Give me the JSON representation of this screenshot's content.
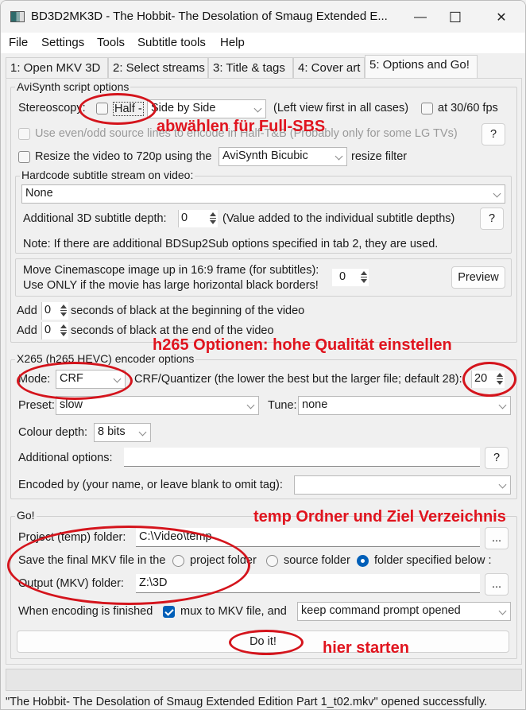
{
  "window": {
    "title": "BD3D2MK3D - The Hobbit- The Desolation of Smaug Extended E...",
    "controls": {
      "minimize": "—",
      "maximize": "☐",
      "close": "✕"
    }
  },
  "menu": [
    "File",
    "Settings",
    "Tools",
    "Subtitle tools",
    "Help"
  ],
  "tabs": [
    {
      "label": "1: Open MKV 3D",
      "active": false
    },
    {
      "label": "2: Select streams",
      "active": false
    },
    {
      "label": "3: Title & tags",
      "active": false
    },
    {
      "label": "4: Cover art",
      "active": false
    },
    {
      "label": "5: Options and Go!",
      "active": true
    }
  ],
  "avisynth": {
    "group_label": "AviSynth script options",
    "stereoscopy_label": "Stereoscopy:",
    "half_label": "Half -",
    "half_checked": false,
    "stereo_mode": "Side by Side",
    "left_view_note": "(Left view first in all cases)",
    "fps_label": "at 30/60 fps",
    "fps_checked": false,
    "even_odd_label": "Use even/odd source lines to encode in Half-T&B (Probably only for some LG TVs)",
    "even_odd_checked": false,
    "help_label": "?",
    "resize_label": "Resize the video to 720p  using the",
    "resize_checked": false,
    "resize_filter": "AviSynth Bicubic",
    "resize_suffix": "resize filter",
    "hardcode": {
      "group_label": "Hardcode subtitle stream on video:",
      "stream": "None",
      "depth_label": "Additional 3D subtitle depth:",
      "depth_value": "0",
      "depth_note": "(Value added to the individual subtitle depths)",
      "help_label": "?",
      "note": "Note:  If there are additional BDSup2Sub options specified in tab 2, they are used."
    },
    "cinemascope": {
      "line1": "Move Cinemascope image up in 16:9 frame (for subtitles):",
      "line2": "Use ONLY if the movie has large horizontal black borders!",
      "value": "0",
      "preview_label": "Preview"
    },
    "black_begin": {
      "prefix": "Add",
      "value": "0",
      "suffix": "seconds of black at the beginning of the video"
    },
    "black_end": {
      "prefix": "Add",
      "value": "0",
      "suffix": "seconds of black at the end of the video"
    }
  },
  "x265": {
    "group_label": "X265 (h265 HEVC) encoder options",
    "mode_label": "Mode:",
    "mode": "CRF",
    "crf_label": "CRF/Quantizer (the lower the best but the larger file; default 28):",
    "crf_value": "20",
    "preset_label": "Preset:",
    "preset": "slow",
    "tune_label": "Tune:",
    "tune": "none",
    "colour_label": "Colour depth:",
    "colour": "8 bits",
    "additional_label": "Additional options:",
    "additional_value": "",
    "help_label": "?",
    "encoded_by_label": "Encoded by (your name, or leave blank to omit tag):",
    "encoded_by_value": ""
  },
  "go": {
    "group_label": "Go!",
    "project_label": "Project (temp) folder:",
    "project_value": "C:\\Video\\temp",
    "browse_label": "...",
    "save_label": "Save the final MKV file in the",
    "radio_project": "project folder",
    "radio_source": "source folder",
    "radio_specified": "folder specified below :",
    "selected_radio": "folder specified below :",
    "output_label": "Output (MKV) folder:",
    "output_value": "Z:\\3D",
    "finished_label": "When encoding is finished",
    "mux_checked": true,
    "mux_label": "mux to MKV file,  and",
    "after_action": "keep command prompt opened",
    "doit_label": "Do it!"
  },
  "progress": 0,
  "status": "\"The Hobbit- The Desolation of Smaug Extended Edition Part 1_t02.mkv\" opened successfully.",
  "annotations": {
    "color": "#e0141e",
    "full_sbs": "abwählen für Full-SBS",
    "h265": "h265 Optionen: hohe Qualität einstellen",
    "folders": "temp Ordner und Ziel Verzeichnis",
    "start": "hier starten"
  }
}
